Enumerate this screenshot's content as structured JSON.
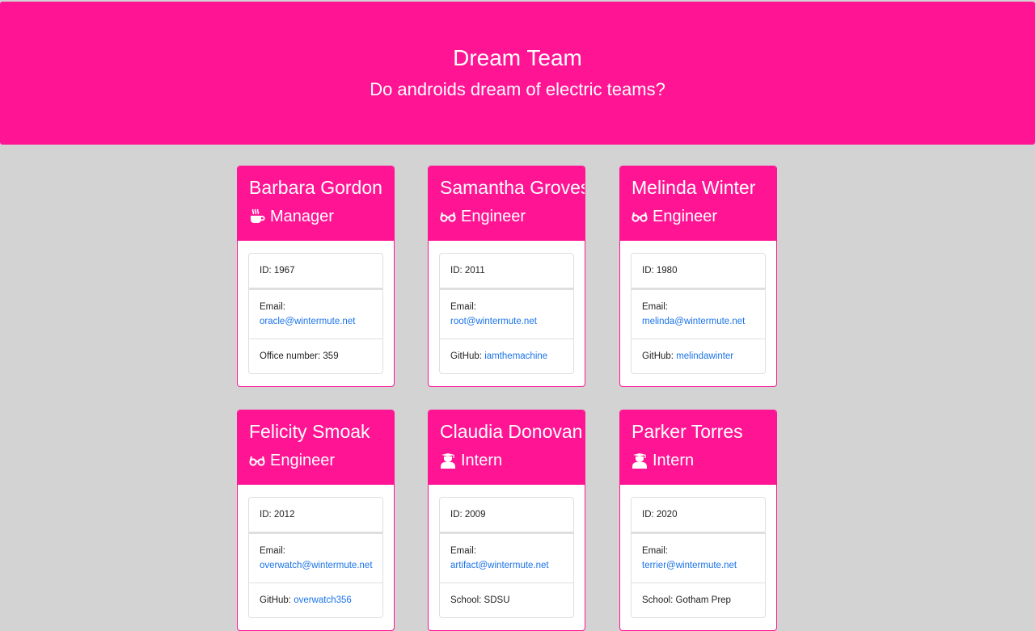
{
  "header": {
    "title": "Dream Team",
    "subtitle": "Do androids dream of electric teams?"
  },
  "colors": {
    "accent": "#ff1493",
    "background": "#d3d3d3",
    "link": "#1a73e8"
  },
  "employees": [
    {
      "name": "Barbara Gordon",
      "role": "Manager",
      "icon": "coffee-icon",
      "id_label": "ID: 1967",
      "email_label": "Email: ",
      "email": "oracle@wintermute.net",
      "extra_label": "Office number: 359",
      "extra_link": ""
    },
    {
      "name": "Samantha Groves",
      "role": "Engineer",
      "icon": "glasses-icon",
      "id_label": "ID: 2011",
      "email_label": "Email: ",
      "email": "root@wintermute.net",
      "extra_label": "GitHub: ",
      "extra_link": "iamthemachine"
    },
    {
      "name": "Melinda Winter",
      "role": "Engineer",
      "icon": "glasses-icon",
      "id_label": "ID: 1980",
      "email_label": "Email:",
      "email": "melinda@wintermute.net",
      "extra_label": "GitHub: ",
      "extra_link": "melindawinter"
    },
    {
      "name": "Felicity Smoak",
      "role": "Engineer",
      "icon": "glasses-icon",
      "id_label": "ID: 2012",
      "email_label": "Email:",
      "email": "overwatch@wintermute.net",
      "extra_label": "GitHub: ",
      "extra_link": "overwatch356"
    },
    {
      "name": "Claudia Donovan",
      "role": "Intern",
      "icon": "graduate-icon",
      "id_label": "ID: 2009",
      "email_label": "Email:",
      "email": "artifact@wintermute.net",
      "extra_label": "School: SDSU",
      "extra_link": ""
    },
    {
      "name": "Parker Torres",
      "role": "Intern",
      "icon": "graduate-icon",
      "id_label": "ID: 2020",
      "email_label": "Email: ",
      "email": "terrier@wintermute.net",
      "extra_label": "School: Gotham Prep",
      "extra_link": ""
    }
  ]
}
